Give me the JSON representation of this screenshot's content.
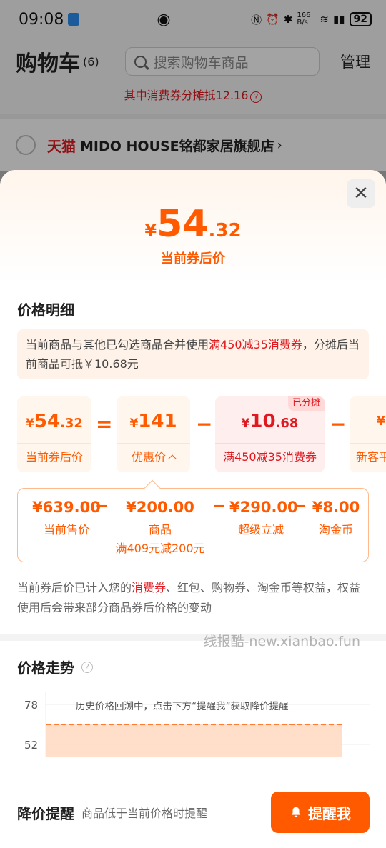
{
  "status_bar": {
    "time": "09:08",
    "net_speed": "166 B/s",
    "battery": "92"
  },
  "cart": {
    "title": "购物车",
    "count": "(6)",
    "search_placeholder": "搜索购物车商品",
    "manage": "管理",
    "coupon_tip": "其中消费券分摊抵12.16",
    "shop_brand": "天猫",
    "shop_name": "MIDO HOUSE铭都家居旗舰店"
  },
  "sheet": {
    "close": "✕",
    "price": {
      "currency": "¥",
      "int": "54",
      "dec": ".32"
    },
    "price_label": "当前券后价",
    "detail_title": "价格明细",
    "note_pre": "当前商品与其他已勾选商品合并使用",
    "note_hl": "满450减35消费券",
    "note_post": "，分摊后当前商品可抵￥10.68元",
    "formula": [
      {
        "currency": "¥",
        "int": "54",
        "dec": ".32",
        "label": "当前券后价"
      },
      {
        "currency": "¥",
        "int": "141",
        "dec": "",
        "label": "优惠价"
      },
      {
        "currency": "¥",
        "int": "10",
        "dec": ".68",
        "label": "满450减35消费券",
        "tag": "已分摊"
      },
      {
        "currency": "¥",
        "int": "",
        "dec": "",
        "label": "新客平"
      }
    ],
    "operators": {
      "eq": "=",
      "minus": "−"
    },
    "breakdown": [
      {
        "value": "¥639.00",
        "label": "当前售价",
        "note": ""
      },
      {
        "value": "¥200.00",
        "label": "商品",
        "note": "满409元减200元"
      },
      {
        "value": "¥290.00",
        "label": "超级立减",
        "note": ""
      },
      {
        "value": "¥8.00",
        "label": "淘金币",
        "note": ""
      }
    ],
    "rights_pre": "当前券后价已计入您的",
    "rights_hl": "消费券",
    "rights_post": "、红包、购物券、淘金币等权益，权益使用后会带来部分商品券后价格的变动",
    "watermark": "线报酷-new.xianbao.fun",
    "trend_title": "价格走势",
    "chart_data": {
      "type": "area",
      "title": "",
      "ytick_labels": [
        "78",
        "52"
      ],
      "annotation": "历史价格回溯中，点击下方“提醒我”获取降价提醒",
      "current_price_line": "dashed",
      "colors": {
        "line": "#ff5a00",
        "fill": "#ffd9bf"
      }
    },
    "remind_title": "降价提醒",
    "remind_desc": "商品低于当前价格时提醒",
    "remind_button": "提醒我"
  }
}
